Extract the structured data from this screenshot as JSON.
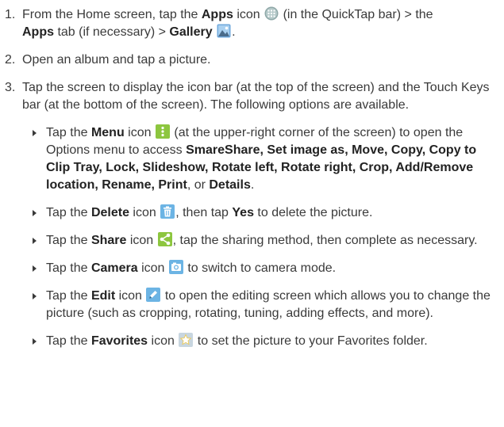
{
  "step1": {
    "num": "1.",
    "t1": "From the Home screen, tap the ",
    "apps": "Apps",
    "t2": " icon ",
    "t3": " (in the QuickTap bar) > the",
    "apps_tab": "Apps",
    "t4": " tab (if necessary) > ",
    "gallery": "Gallery",
    "t5": "."
  },
  "step2": {
    "num": "2.",
    "text": "Open an album and tap a picture."
  },
  "step3": {
    "num": "3.",
    "text": "Tap the screen to display the icon bar (at the top of the screen) and the Touch Keys bar (at the bottom of the screen). The following options are available."
  },
  "bullets": {
    "menu": {
      "t1": "Tap the ",
      "label": "Menu",
      "t2": " icon ",
      "t3": " (at the upper-right corner of the screen) to open the Options menu to access ",
      "options": "SmareShare, Set image as, Move, Copy, Copy to Clip Tray, Lock, Slideshow, Rotate left, Rotate right, Crop, Add/Remove location, Rename, Print",
      "t4": ", or ",
      "details": "Details",
      "t5": "."
    },
    "delete": {
      "t1": "Tap the ",
      "label": "Delete",
      "t2": " icon ",
      "t3": ", then tap ",
      "yes": "Yes",
      "t4": " to delete the picture."
    },
    "share": {
      "t1": "Tap the ",
      "label": "Share",
      "t2": " icon ",
      "t3": ", tap the sharing method, then complete as necessary."
    },
    "camera": {
      "t1": "Tap the ",
      "label": "Camera",
      "t2": " icon ",
      "t3": " to switch to camera mode."
    },
    "edit": {
      "t1": "Tap the ",
      "label": "Edit",
      "t2": " icon ",
      "t3": " to open the editing screen which allows you to change the picture (such as cropping, rotating, tuning, adding effects, and more)."
    },
    "favorites": {
      "t1": "Tap the ",
      "label": "Favorites",
      "t2": " icon ",
      "t3": " to set the picture to your Favorites folder."
    }
  },
  "icons": {
    "apps": "apps-grid-icon",
    "gallery": "gallery-icon",
    "menu": "menu-icon",
    "delete": "trash-icon",
    "share": "share-icon",
    "camera": "camera-icon",
    "edit": "edit-icon",
    "favorites": "star-icon"
  },
  "colors": {
    "text": "#3a3a3a",
    "icon_green": "#8dc63f",
    "icon_blue": "#5aa9e6",
    "apps_icon": "#8fa8a8"
  }
}
